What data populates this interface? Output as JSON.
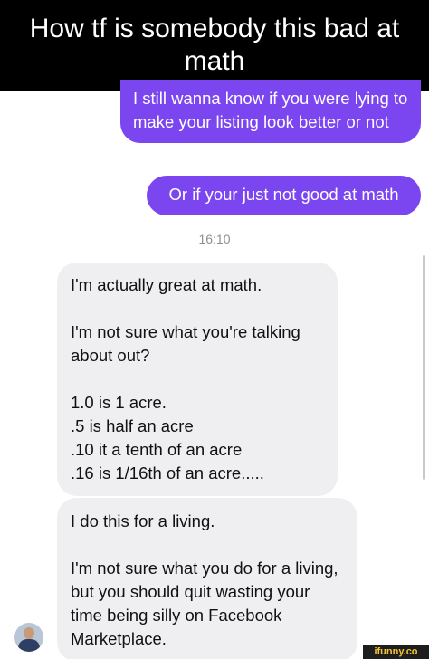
{
  "caption": "How tf is somebody this bad at math",
  "messages": {
    "sent_1": "I still wanna know if you were lying to make your listing look better or not",
    "sent_2": "Or if your just not good at math",
    "timestamp": "16:10",
    "reply_1": {
      "p1": "I'm actually great at math.",
      "p2": "I'm not sure what you're talking about out?",
      "p3": "1.0 is 1 acre.\n.5 is half an acre\n.10 it a tenth of an acre\n.16 is 1/16th of an acre....."
    },
    "reply_2": {
      "p1": "I do this for a living.",
      "p2": "I'm not sure what you do for a living, but you should quit wasting your time being silly on Facebook Marketplace."
    }
  },
  "colors": {
    "sent_bubble": "#7B45F0",
    "received_bubble": "#EFEFF1",
    "caption_background": "#000000"
  },
  "watermark": "ifunny.co"
}
